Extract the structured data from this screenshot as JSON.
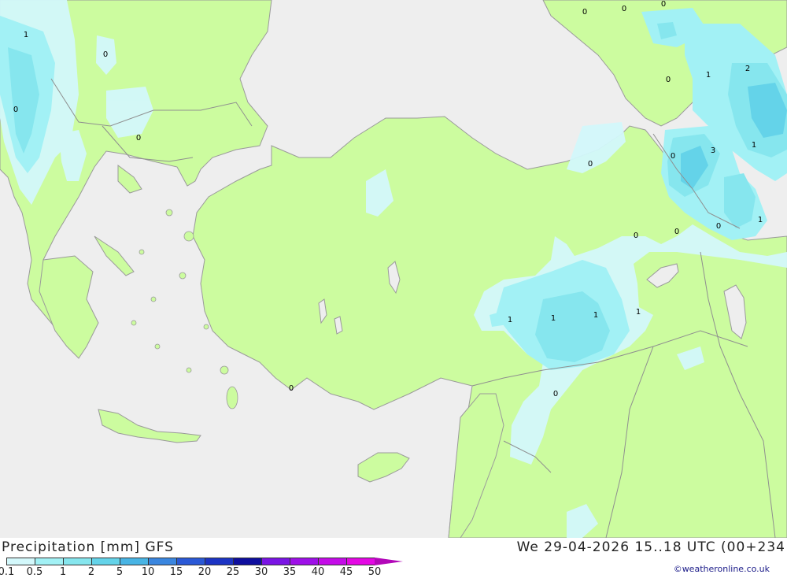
{
  "map": {
    "colors": {
      "sea": "#eeeeee",
      "land": "#ccfc9f",
      "border": "#9a9a9a",
      "precip_01": "#d3f8fb",
      "precip_05": "#a2f1f5",
      "precip_1": "#86e6ee",
      "precip_2": "#64d3e9"
    },
    "contour_labels": [
      {
        "text": "1"
      },
      {
        "text": "0"
      },
      {
        "text": "0"
      },
      {
        "text": "0"
      },
      {
        "text": "0"
      },
      {
        "text": "0"
      },
      {
        "text": "0"
      },
      {
        "text": "0"
      },
      {
        "text": "1"
      },
      {
        "text": "2"
      },
      {
        "text": "3"
      },
      {
        "text": "1"
      },
      {
        "text": "0"
      },
      {
        "text": "0"
      },
      {
        "text": "0"
      },
      {
        "text": "0"
      },
      {
        "text": "0"
      },
      {
        "text": "1"
      },
      {
        "text": "1"
      },
      {
        "text": "1"
      },
      {
        "text": "1"
      },
      {
        "text": "1"
      },
      {
        "text": "0"
      },
      {
        "text": "0"
      }
    ]
  },
  "footer": {
    "title": "Precipitation [mm] GFS",
    "valid_time": "We 29-04-2026 15..18 UTC (00+234",
    "credit": "©weatheronline.co.uk",
    "legend": [
      {
        "label": "0.1",
        "color": "#d3f8fb"
      },
      {
        "label": "0.5",
        "color": "#a2f1f5"
      },
      {
        "label": "1",
        "color": "#86e6ee"
      },
      {
        "label": "2",
        "color": "#64d3e9"
      },
      {
        "label": "5",
        "color": "#48b4e4"
      },
      {
        "label": "10",
        "color": "#3a86df"
      },
      {
        "label": "15",
        "color": "#2a59d6"
      },
      {
        "label": "20",
        "color": "#1c34c4"
      },
      {
        "label": "25",
        "color": "#0e0e9e"
      },
      {
        "label": "30",
        "color": "#7a14e4"
      },
      {
        "label": "35",
        "color": "#9e10e8"
      },
      {
        "label": "40",
        "color": "#c40ce8"
      },
      {
        "label": "45",
        "color": "#e408e4"
      },
      {
        "label": "50",
        "color": "#b208b8"
      }
    ]
  }
}
